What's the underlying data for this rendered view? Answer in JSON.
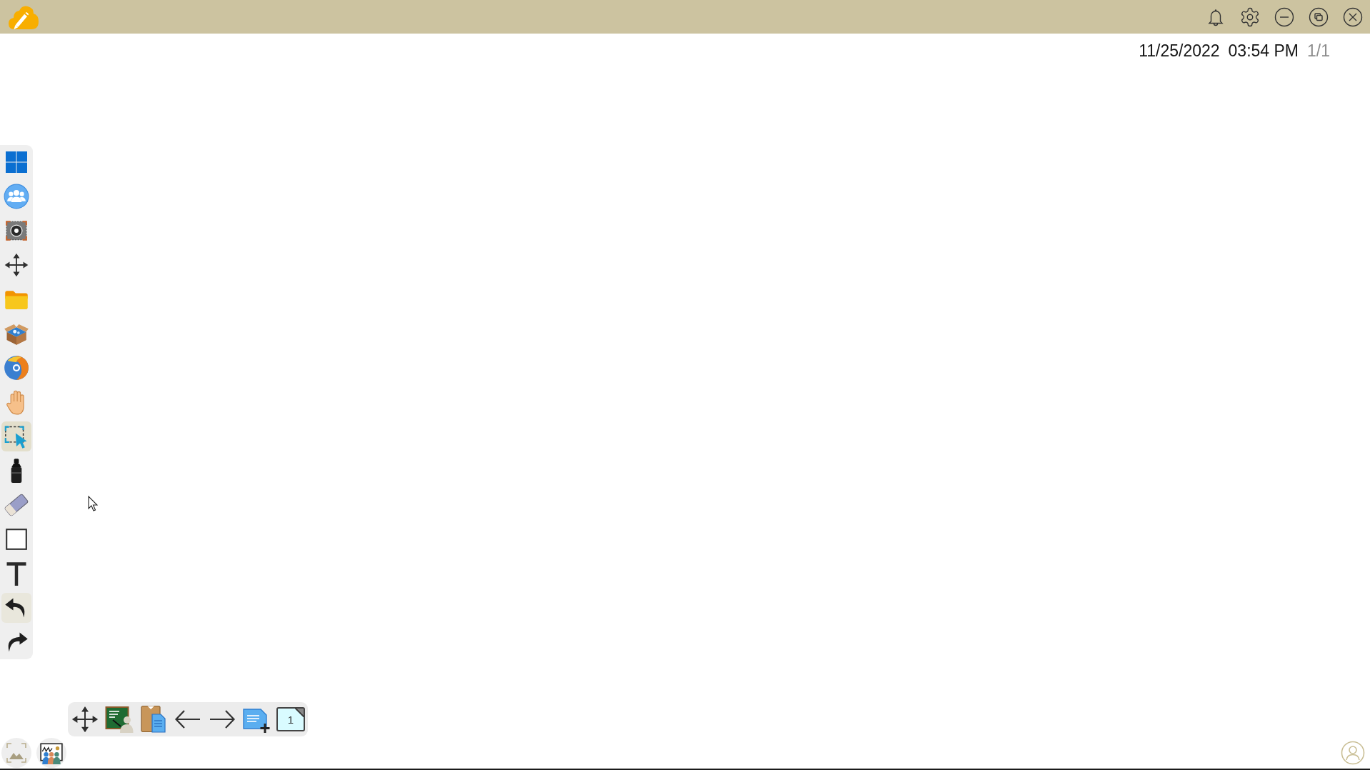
{
  "header": {
    "date": "11/25/2022",
    "time": "03:54 PM",
    "page_count": "1/1"
  },
  "tool_palette": [
    {
      "kind": "tiles",
      "selected": false,
      "hovered": false
    },
    {
      "kind": "people",
      "selected": false,
      "hovered": false
    },
    {
      "kind": "capture",
      "selected": false,
      "hovered": false
    },
    {
      "kind": "move",
      "selected": false,
      "hovered": false
    },
    {
      "kind": "folder",
      "selected": false,
      "hovered": false
    },
    {
      "kind": "box",
      "selected": false,
      "hovered": false
    },
    {
      "kind": "disc",
      "selected": false,
      "hovered": false
    },
    {
      "kind": "hand",
      "selected": false,
      "hovered": false
    },
    {
      "kind": "select",
      "selected": true,
      "hovered": false
    },
    {
      "kind": "marker",
      "selected": false,
      "hovered": false
    },
    {
      "kind": "eraser",
      "selected": false,
      "hovered": false
    },
    {
      "kind": "rectangle",
      "selected": false,
      "hovered": false
    },
    {
      "kind": "text",
      "selected": false,
      "hovered": false
    },
    {
      "kind": "undo",
      "selected": false,
      "hovered": true
    },
    {
      "kind": "redo",
      "selected": false,
      "hovered": false
    }
  ],
  "page_toolbar": [
    {
      "kind": "move"
    },
    {
      "kind": "teach"
    },
    {
      "kind": "clipboard"
    },
    {
      "kind": "prev"
    },
    {
      "kind": "next"
    },
    {
      "kind": "add_page"
    },
    {
      "kind": "page",
      "label": "1"
    }
  ]
}
